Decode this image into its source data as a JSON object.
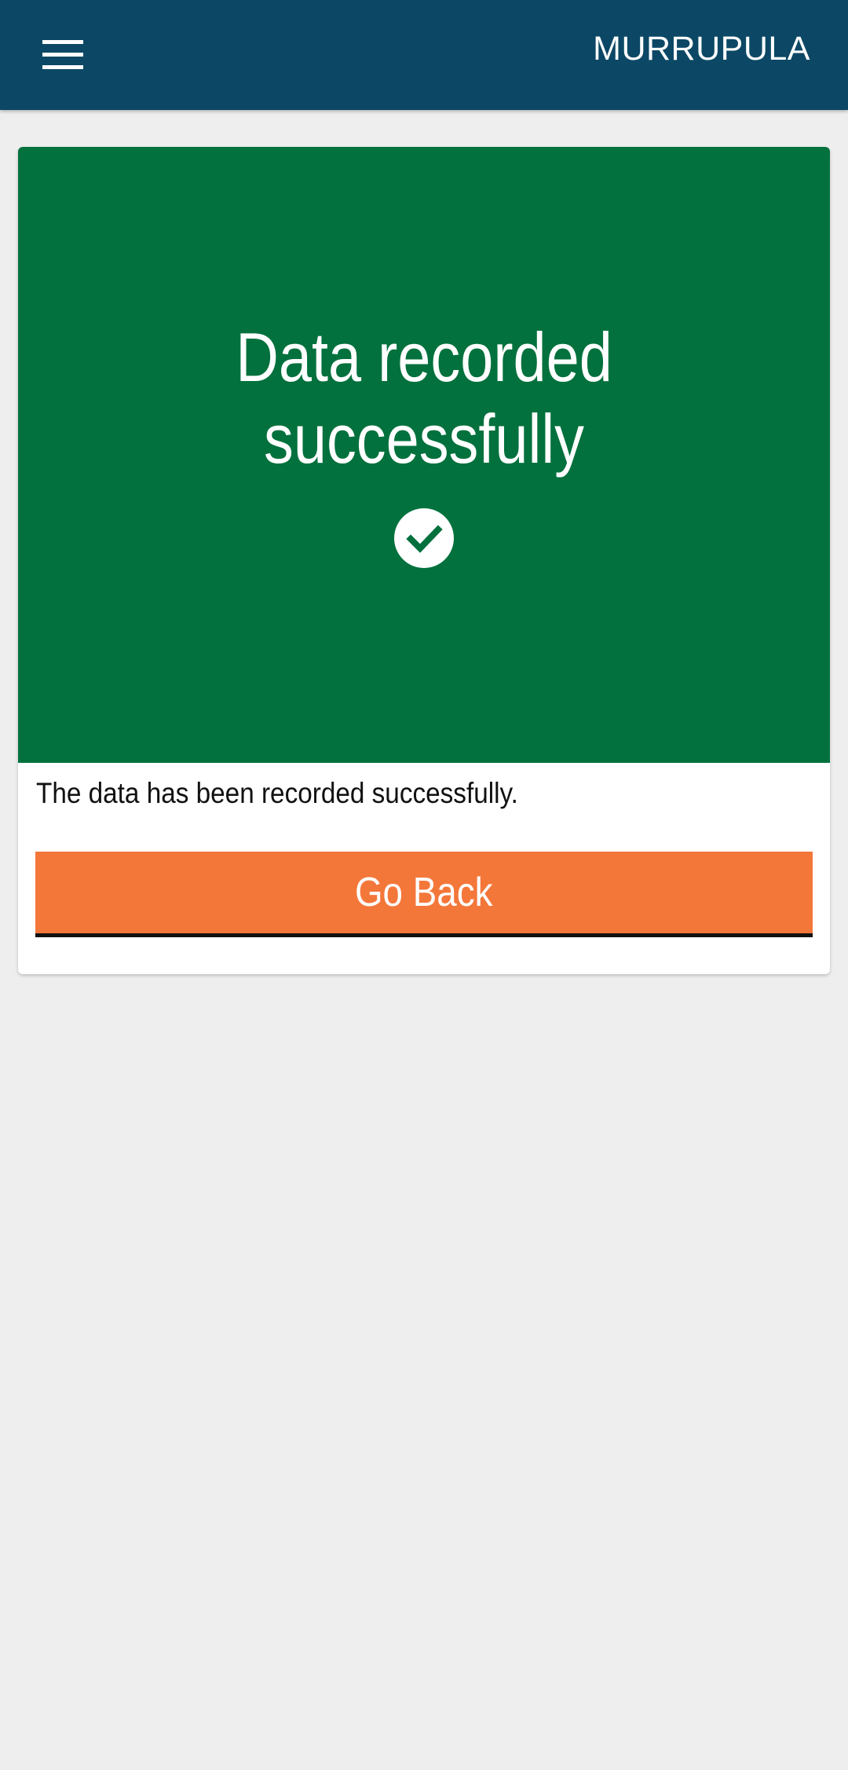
{
  "app_bar": {
    "title": "MURRUPULA",
    "menu_icon": "hamburger-menu-icon",
    "background_color": "#0c4865"
  },
  "card": {
    "banner": {
      "title_line1": "Data recorded",
      "title_line2": "successfully",
      "icon": "check-circle-icon",
      "background_color": "#02713d"
    },
    "message": "The data has been recorded successfully.",
    "go_back_label": "Go Back",
    "button_color": "#f4773a"
  }
}
